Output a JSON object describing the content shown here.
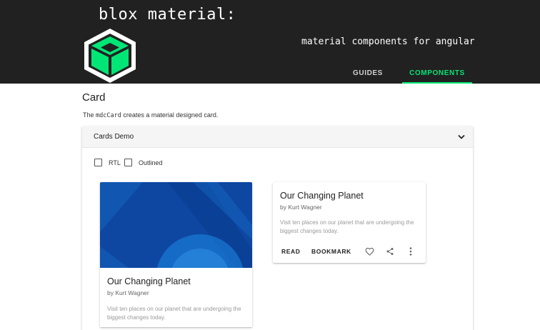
{
  "header": {
    "brand_title": "blox material:",
    "tagline": "material components for angular",
    "tabs": [
      {
        "label": "GUIDES",
        "active": false
      },
      {
        "label": "COMPONENTS",
        "active": true
      }
    ],
    "colors": {
      "background": "#212121",
      "accent": "#00e676"
    },
    "logo_icon": "cube-logo-icon"
  },
  "page": {
    "title": "Card",
    "desc_prefix": "The ",
    "desc_code": "mdcCard",
    "desc_suffix": " creates a material designed card."
  },
  "demo": {
    "title": "Cards Demo",
    "expand_icon": "chevron-down-icon",
    "options": [
      {
        "label": "RTL",
        "checked": false
      },
      {
        "label": "Outlined",
        "checked": false
      }
    ],
    "cards": [
      {
        "title": "Our Changing Planet",
        "subtitle": "by Kurt Wagner",
        "body": "Visit ten places on our planet that are undergoing the biggest changes today.",
        "has_media": true
      },
      {
        "title": "Our Changing Planet",
        "subtitle": "by Kurt Wagner",
        "body": "Visit ten places on our planet that are undergoing the biggest changes today.",
        "actions": [
          "READ",
          "BOOKMARK"
        ],
        "icons": [
          "heart-icon",
          "share-icon",
          "more-vert-icon"
        ]
      }
    ]
  }
}
